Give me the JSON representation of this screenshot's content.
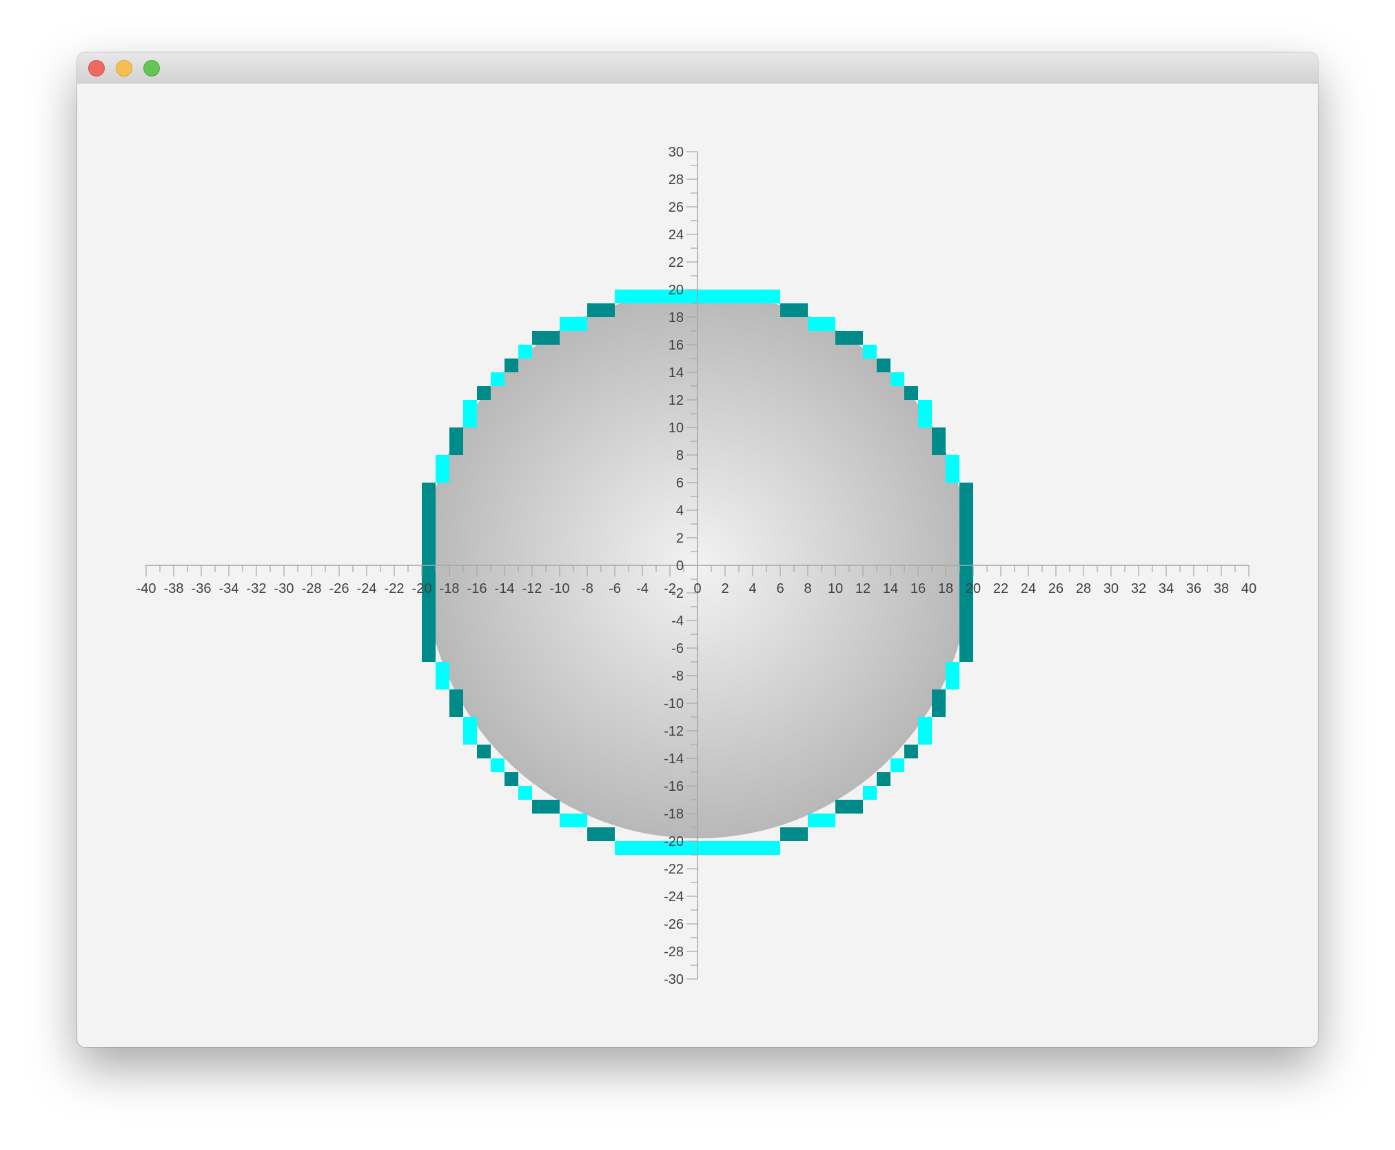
{
  "window": {
    "controls": [
      "close",
      "minimize",
      "maximize"
    ]
  },
  "colors": {
    "window_bg": "#f3f3f3",
    "axis": "#a6a6a6",
    "tick_text": "#404040",
    "pixel_light": "#00ffff",
    "pixel_dark": "#008b8b",
    "circle_center": "#f2f2f2",
    "circle_edge": "#b8b8b8"
  },
  "chart_data": {
    "type": "scatter",
    "title": "",
    "xlabel": "",
    "ylabel": "",
    "xlim": [
      -40,
      40
    ],
    "ylim": [
      -30,
      30
    ],
    "x_ticks": [
      "-40",
      "-38",
      "-36",
      "-34",
      "-32",
      "-30",
      "-28",
      "-26",
      "-24",
      "-22",
      "-20",
      "-18",
      "-16",
      "-14",
      "-12",
      "-10",
      "-8",
      "-6",
      "-4",
      "-2",
      "0",
      "2",
      "4",
      "6",
      "8",
      "10",
      "12",
      "14",
      "16",
      "18",
      "20",
      "22",
      "24",
      "26",
      "28",
      "30",
      "32",
      "34",
      "36",
      "38",
      "40"
    ],
    "y_ticks": [
      "30",
      "28",
      "26",
      "24",
      "22",
      "20",
      "18",
      "16",
      "14",
      "12",
      "10",
      "8",
      "6",
      "4",
      "2",
      "0",
      "-2",
      "-4",
      "-6",
      "-8",
      "-10",
      "-12",
      "-14",
      "-16",
      "-18",
      "-20",
      "-22",
      "-24",
      "-26",
      "-28",
      "-30"
    ],
    "circle": {
      "center": [
        0,
        0
      ],
      "radius": 19.8
    },
    "series": [
      {
        "points": [
          [
            -6,
            19
          ],
          [
            -5,
            19
          ],
          [
            -4,
            19
          ],
          [
            -3,
            19
          ],
          [
            -2,
            19
          ],
          [
            -1,
            19
          ],
          [
            0,
            19
          ],
          [
            1,
            19
          ],
          [
            2,
            19
          ],
          [
            3,
            19
          ],
          [
            4,
            19
          ],
          [
            5,
            19
          ],
          [
            -10,
            17
          ],
          [
            -9,
            17
          ],
          [
            8,
            17
          ],
          [
            9,
            17
          ],
          [
            -13,
            15
          ],
          [
            12,
            15
          ],
          [
            -15,
            13
          ],
          [
            14,
            13
          ],
          [
            -17,
            11
          ],
          [
            -17,
            10
          ],
          [
            16,
            11
          ],
          [
            16,
            10
          ],
          [
            -19,
            7
          ],
          [
            -19,
            6
          ],
          [
            18,
            7
          ],
          [
            18,
            6
          ],
          [
            -19,
            -8
          ],
          [
            -19,
            -9
          ],
          [
            18,
            -8
          ],
          [
            18,
            -9
          ],
          [
            -17,
            -12
          ],
          [
            -17,
            -13
          ],
          [
            16,
            -12
          ],
          [
            16,
            -13
          ],
          [
            -15,
            -15
          ],
          [
            14,
            -15
          ],
          [
            -13,
            -17
          ],
          [
            12,
            -17
          ],
          [
            -10,
            -19
          ],
          [
            -9,
            -19
          ],
          [
            8,
            -19
          ],
          [
            9,
            -19
          ],
          [
            -6,
            -21
          ],
          [
            -5,
            -21
          ],
          [
            -4,
            -21
          ],
          [
            -3,
            -21
          ],
          [
            -2,
            -21
          ],
          [
            -1,
            -21
          ],
          [
            0,
            -21
          ],
          [
            1,
            -21
          ],
          [
            2,
            -21
          ],
          [
            3,
            -21
          ],
          [
            4,
            -21
          ],
          [
            5,
            -21
          ]
        ]
      },
      {
        "points": [
          [
            -8,
            18
          ],
          [
            -7,
            18
          ],
          [
            6,
            18
          ],
          [
            7,
            18
          ],
          [
            -12,
            16
          ],
          [
            -11,
            16
          ],
          [
            10,
            16
          ],
          [
            11,
            16
          ],
          [
            -14,
            14
          ],
          [
            13,
            14
          ],
          [
            -16,
            12
          ],
          [
            15,
            12
          ],
          [
            -18,
            9
          ],
          [
            -18,
            8
          ],
          [
            17,
            9
          ],
          [
            17,
            8
          ],
          [
            -20,
            5
          ],
          [
            -20,
            4
          ],
          [
            -20,
            3
          ],
          [
            -20,
            2
          ],
          [
            -20,
            1
          ],
          [
            -20,
            0
          ],
          [
            -20,
            -1
          ],
          [
            -20,
            -2
          ],
          [
            -20,
            -3
          ],
          [
            -20,
            -4
          ],
          [
            -20,
            -5
          ],
          [
            -20,
            -6
          ],
          [
            -20,
            -7
          ],
          [
            19,
            5
          ],
          [
            19,
            4
          ],
          [
            19,
            3
          ],
          [
            19,
            2
          ],
          [
            19,
            1
          ],
          [
            19,
            0
          ],
          [
            19,
            -1
          ],
          [
            19,
            -2
          ],
          [
            19,
            -3
          ],
          [
            19,
            -4
          ],
          [
            19,
            -5
          ],
          [
            19,
            -6
          ],
          [
            19,
            -7
          ],
          [
            -18,
            -10
          ],
          [
            -18,
            -11
          ],
          [
            17,
            -10
          ],
          [
            17,
            -11
          ],
          [
            -16,
            -14
          ],
          [
            15,
            -14
          ],
          [
            -14,
            -16
          ],
          [
            13,
            -16
          ],
          [
            -12,
            -18
          ],
          [
            -11,
            -18
          ],
          [
            10,
            -18
          ],
          [
            11,
            -18
          ],
          [
            -8,
            -20
          ],
          [
            -7,
            -20
          ],
          [
            6,
            -20
          ],
          [
            7,
            -20
          ]
        ]
      }
    ]
  }
}
